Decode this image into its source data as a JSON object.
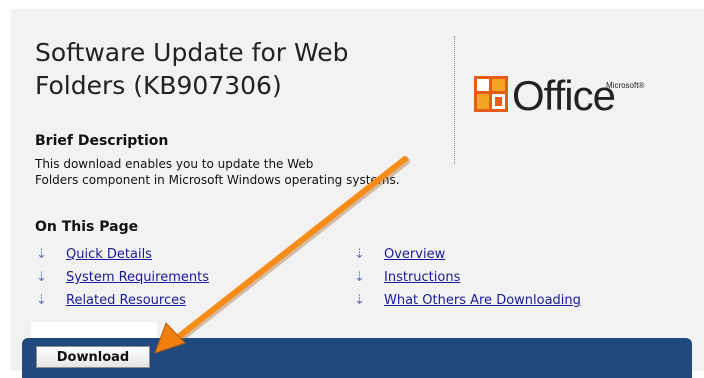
{
  "page": {
    "title_line1": "Software Update for Web",
    "title_line2": "Folders (KB907306)"
  },
  "logo": {
    "text": "Office",
    "superscript": "Microsoft®"
  },
  "brief": {
    "heading": "Brief Description",
    "text_line1": "This download enables you to update the Web",
    "text_line2": "Folders component in Microsoft Windows operating systems."
  },
  "on_page": {
    "heading": "On This Page",
    "left_links": [
      {
        "label": "Quick Details"
      },
      {
        "label": "System Requirements"
      },
      {
        "label": "Related Resources"
      }
    ],
    "right_links": [
      {
        "label": "Overview"
      },
      {
        "label": "Instructions"
      },
      {
        "label": "What Others Are Downloading"
      }
    ]
  },
  "download": {
    "label": "Download"
  },
  "icons": {
    "link_arrow": "down-arrow-icon",
    "annotation": "orange-arrow-icon",
    "logo": "office-logo-icon"
  },
  "colors": {
    "panel_bg": "#f2f2f2",
    "link": "#1b1b99",
    "bar": "#21487f",
    "arrow": "#ff8c1a"
  }
}
